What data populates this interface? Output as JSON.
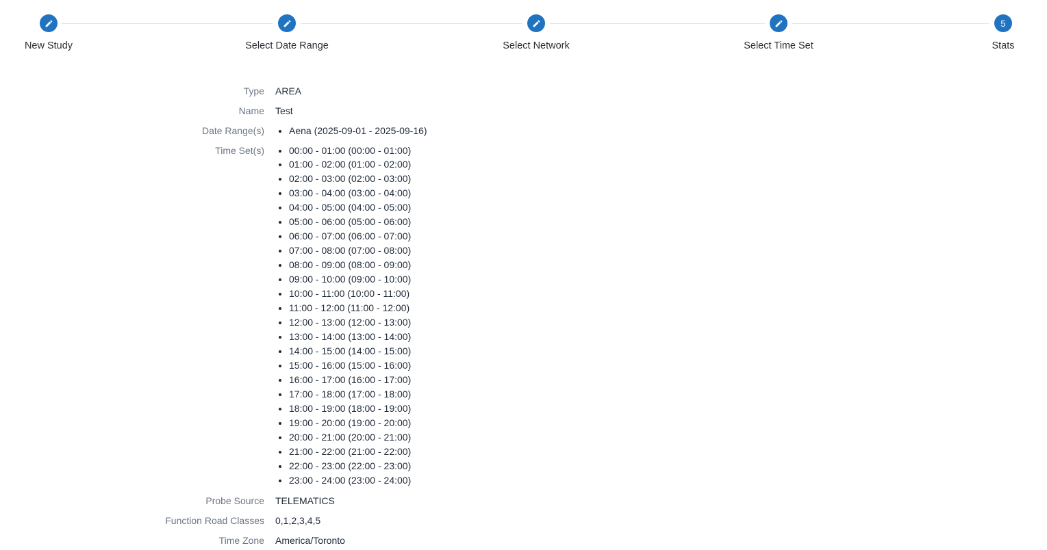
{
  "stepper": {
    "steps": [
      {
        "label": "New Study",
        "marker": "pencil-icon",
        "status": "completed"
      },
      {
        "label": "Select Date Range",
        "marker": "pencil-icon",
        "status": "completed"
      },
      {
        "label": "Select Network",
        "marker": "pencil-icon",
        "status": "completed"
      },
      {
        "label": "Select Time Set",
        "marker": "pencil-icon",
        "status": "completed"
      },
      {
        "label": "Stats",
        "marker": "5",
        "status": "current"
      }
    ],
    "accent_color": "#1f73c1"
  },
  "summary": {
    "type": {
      "label": "Type",
      "value": "AREA"
    },
    "name": {
      "label": "Name",
      "value": "Test"
    },
    "date_ranges": {
      "label": "Date Range(s)",
      "items": [
        "Aena (2025-09-01 - 2025-09-16)"
      ]
    },
    "time_sets": {
      "label": "Time Set(s)",
      "items": [
        "00:00 - 01:00 (00:00 - 01:00)",
        "01:00 - 02:00 (01:00 - 02:00)",
        "02:00 - 03:00 (02:00 - 03:00)",
        "03:00 - 04:00 (03:00 - 04:00)",
        "04:00 - 05:00 (04:00 - 05:00)",
        "05:00 - 06:00 (05:00 - 06:00)",
        "06:00 - 07:00 (06:00 - 07:00)",
        "07:00 - 08:00 (07:00 - 08:00)",
        "08:00 - 09:00 (08:00 - 09:00)",
        "09:00 - 10:00 (09:00 - 10:00)",
        "10:00 - 11:00 (10:00 - 11:00)",
        "11:00 - 12:00 (11:00 - 12:00)",
        "12:00 - 13:00 (12:00 - 13:00)",
        "13:00 - 14:00 (13:00 - 14:00)",
        "14:00 - 15:00 (14:00 - 15:00)",
        "15:00 - 16:00 (15:00 - 16:00)",
        "16:00 - 17:00 (16:00 - 17:00)",
        "17:00 - 18:00 (17:00 - 18:00)",
        "18:00 - 19:00 (18:00 - 19:00)",
        "19:00 - 20:00 (19:00 - 20:00)",
        "20:00 - 21:00 (20:00 - 21:00)",
        "21:00 - 22:00 (21:00 - 22:00)",
        "22:00 - 23:00 (22:00 - 23:00)",
        "23:00 - 24:00 (23:00 - 24:00)"
      ]
    },
    "probe_source": {
      "label": "Probe Source",
      "value": "TELEMATICS"
    },
    "function_road_classes": {
      "label": "Function Road Classes",
      "value": "0,1,2,3,4,5"
    },
    "time_zone": {
      "label": "Time Zone",
      "value": "America/Toronto"
    }
  }
}
